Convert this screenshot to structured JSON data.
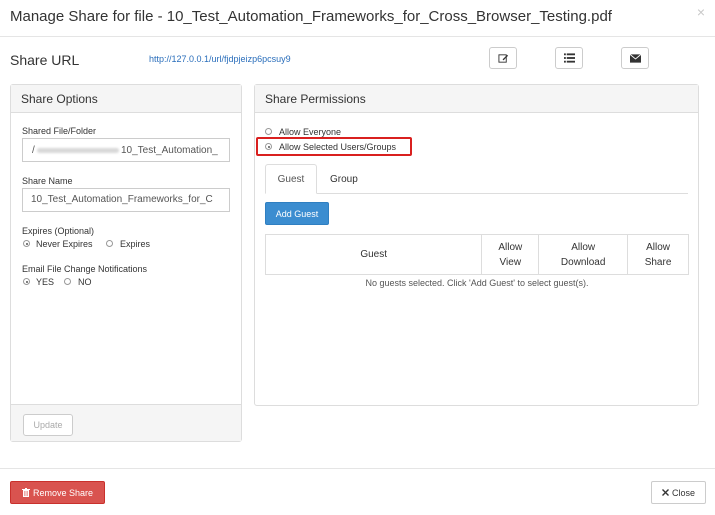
{
  "modal": {
    "title": "Manage Share for file - 10_Test_Automation_Frameworks_for_Cross_Browser_Testing.pdf",
    "close_glyph": "×"
  },
  "share_url": {
    "label": "Share URL",
    "url": "http://127.0.0.1/url/fjdpjeizp6pcsuy9",
    "actions": [
      "edit-icon",
      "list-icon",
      "envelope-icon"
    ]
  },
  "share_options": {
    "heading": "Share Options",
    "shared_file_label": "Shared File/Folder",
    "shared_file_value": "10_Test_Automation_",
    "shared_file_prefix": "/",
    "share_name_label": "Share Name",
    "share_name_value": "10_Test_Automation_Frameworks_for_C",
    "expires_label": "Expires (Optional)",
    "expires_options": [
      {
        "label": "Never Expires",
        "selected": true
      },
      {
        "label": "Expires",
        "selected": false
      }
    ],
    "notify_label": "Email File Change Notifications",
    "notify_options": [
      {
        "label": "YES",
        "selected": true
      },
      {
        "label": "NO",
        "selected": false
      }
    ],
    "update_label": "Update"
  },
  "share_permissions": {
    "heading": "Share Permissions",
    "options": [
      {
        "label": "Allow Everyone",
        "selected": false
      },
      {
        "label": "Allow Selected Users/Groups",
        "selected": true
      }
    ],
    "tabs": [
      {
        "label": "Guest",
        "active": true
      },
      {
        "label": "Group",
        "active": false
      }
    ],
    "add_guest_label": "Add Guest",
    "columns": [
      "Guest",
      "Allow\nView",
      "Allow\nDownload",
      "Allow\nShare"
    ],
    "empty_message": "No guests selected. Click 'Add Guest' to select guest(s)."
  },
  "footer": {
    "remove_label": "Remove Share",
    "remove_icon": "trash-icon",
    "close_label": "Close",
    "close_icon": "close-icon"
  },
  "colors": {
    "primary": "#3b8dd0",
    "danger": "#d9534f",
    "highlight": "#d9201f",
    "link": "#2a6ebb"
  }
}
